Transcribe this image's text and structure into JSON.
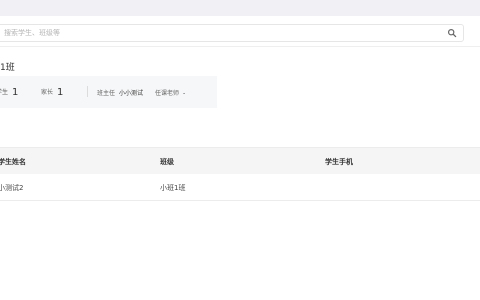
{
  "search": {
    "placeholder": "搜索学生、班级等"
  },
  "class_info": {
    "title": "1班",
    "student_label": "学生",
    "student_count": "1",
    "parent_label": "家长",
    "parent_count": "1",
    "head_teacher_label": "班主任",
    "head_teacher_name": "小小测试",
    "subject_teacher_label": "任课老师",
    "subject_teacher_value": "-"
  },
  "table": {
    "headers": [
      "学生姓名",
      "班级",
      "学生手机"
    ],
    "rows": [
      [
        "小测试2",
        "小班1班",
        ""
      ]
    ]
  }
}
